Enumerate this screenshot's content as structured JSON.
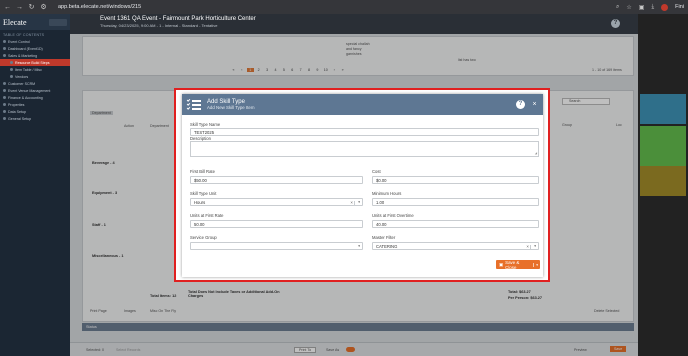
{
  "browser": {
    "url": "app.beta.elecate.net/windows/215",
    "profile_label": "Fini"
  },
  "sidebar": {
    "logo": "Elecate",
    "toc_title": "TABLE OF CONTENTS",
    "items": [
      {
        "label": "Event Control"
      },
      {
        "label": "Dashboard (Event1D)"
      },
      {
        "label": "Sales & Marketing"
      },
      {
        "label": "Resource Build Steps"
      },
      {
        "label": "Item Table / Misc"
      },
      {
        "label": "Vendors"
      },
      {
        "label": "Customer SCRM"
      },
      {
        "label": "Event Venue Management"
      },
      {
        "label": "Finance & Accounting"
      },
      {
        "label": "Properties"
      },
      {
        "label": "Data Setup"
      },
      {
        "label": "General Setup"
      }
    ]
  },
  "header": {
    "title": "Event 1361 QA Event - Fairmount Park Horticulture Center",
    "subtitle": "Thursday, 04/23/2025, 9:00 AM - 1 - Internal - Standard - Tentative"
  },
  "background": {
    "pager": {
      "pages": [
        "1",
        "2",
        "3",
        "4",
        "5",
        "6",
        "7",
        "8",
        "9",
        "10"
      ],
      "current": "1",
      "range": "1 - 10 of 169 items"
    },
    "cell_notes": [
      "special challah",
      "and fancy",
      "garnishes"
    ],
    "list_note": "list has two",
    "department_label": "Department",
    "col_action": "Action",
    "col_department": "Department",
    "col_group": "Group",
    "col_loc": "Loc",
    "search_placeholder": "Search",
    "row_groups": [
      {
        "label": "Beverage - 4"
      },
      {
        "label": "Equipment - 3"
      },
      {
        "label": "Staff - 1"
      },
      {
        "label": "Miscellaneous - 1"
      }
    ],
    "total_items": "Total Items: 12",
    "total_note": "Total Does Not Include Taxes or Additional Add-On Charges",
    "total": "Total: $63.27",
    "per_person": "Per Person: $63.27",
    "footer_buttons": [
      "Print Page",
      "Images",
      "Misc On The Fly"
    ],
    "delete_selected": "Delete Selected",
    "status_label": "Status",
    "selected_label": "Selected: 0",
    "select_records": "Select Records",
    "print_to": "Print To",
    "save_as": "Save As",
    "preview": "Preview",
    "save_btn": "Save"
  },
  "modal": {
    "title": "Add Skill Type",
    "subtitle": "Add New Skill Type Item",
    "fields": {
      "skill_type_name": {
        "label": "Skill Type Name",
        "value": "TEST2025"
      },
      "description": {
        "label": "Description",
        "value": ""
      },
      "first_bill_rate": {
        "label": "First Bill Rate",
        "value": "$50.00"
      },
      "cost": {
        "label": "Cost",
        "value": "$0.00"
      },
      "skill_type_unit": {
        "label": "Skill Type Unit",
        "value": "Hours"
      },
      "minimum_hours": {
        "label": "Minimum Hours",
        "value": "1.00"
      },
      "units_first_rate": {
        "label": "Units at First Rate",
        "value": "50.00"
      },
      "units_first_overtime": {
        "label": "Units at First Overtime",
        "value": "40.00"
      },
      "service_group": {
        "label": "Service Group",
        "value": ""
      },
      "master_filter": {
        "label": "Master Filter",
        "value": "CATERING"
      }
    },
    "save_close_label": "Save & Close"
  },
  "colors": {
    "modal_header": "#5e7793",
    "accent": "#e8702a",
    "highlight_border": "#e02020",
    "sidebar_active": "#c0392b"
  }
}
